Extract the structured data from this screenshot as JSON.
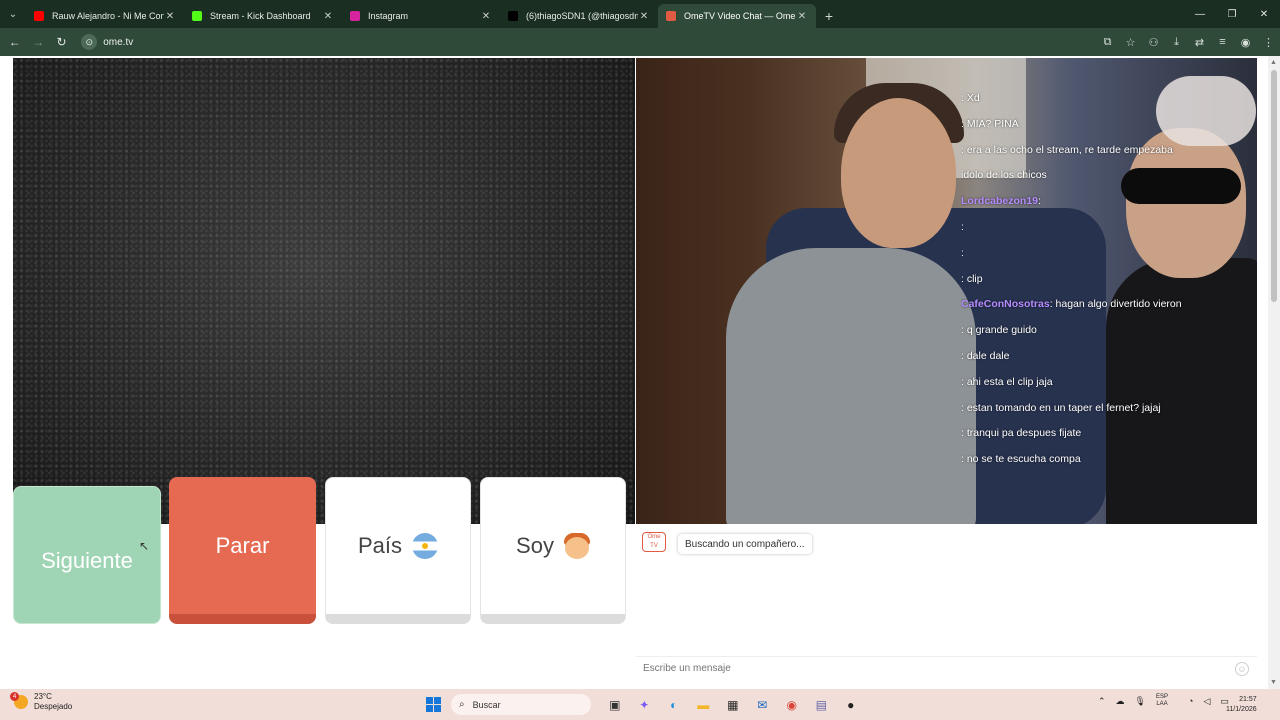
{
  "browser": {
    "tabs": [
      {
        "title": "Rauw Alejandro - Ni Me Conoc",
        "favicon_color": "#ff0000",
        "active": false
      },
      {
        "title": "Stream - Kick Dashboard",
        "favicon_color": "#53fc18",
        "active": false
      },
      {
        "title": "Instagram",
        "favicon_color": "#d6249f",
        "active": false
      },
      {
        "title": "(6)thiagoSDN1 (@thiagosdn1)",
        "favicon_color": "#000000",
        "active": false
      },
      {
        "title": "OmeTV Video Chat — Ome",
        "favicon_color": "#e05a44",
        "active": true
      }
    ],
    "new_tab": "+",
    "url": "ome.tv",
    "window_controls": {
      "minimize": "—",
      "maximize": "❐",
      "close": "✕"
    }
  },
  "video": {
    "chat_overlay": [
      {
        "user": "",
        "message": ": Xd"
      },
      {
        "user": "",
        "message": ": MIA? PINA"
      },
      {
        "user": "",
        "message": ": era a las ocho el stream, re tarde empezaba"
      },
      {
        "user": "",
        "message": "idolo de los chicos"
      },
      {
        "user": "Lordcabezon19",
        "message": ":"
      },
      {
        "user": "",
        "message": ":"
      },
      {
        "user": "",
        "message": ":"
      },
      {
        "user": "",
        "message": ": clip"
      },
      {
        "user": "CafeConNosotras",
        "message": ": hagan algo divertido vieron"
      },
      {
        "user": "",
        "message": ": q grande guido"
      },
      {
        "user": "",
        "message": ": dale dale"
      },
      {
        "user": "",
        "message": ": ahi esta el clip jaja"
      },
      {
        "user": "",
        "message": ": estan tomando en un taper el fernet? jajaj"
      },
      {
        "user": "",
        "message": ": tranqui pa despues fijate"
      },
      {
        "user": "",
        "message": ": no se te escucha compa"
      }
    ]
  },
  "controls": {
    "next_label": "Siguiente",
    "stop_label": "Parar",
    "country_label": "País",
    "soy_label": "Soy",
    "next_color": "#9fd5b4",
    "stop_color": "#e66a52"
  },
  "chat": {
    "logo_text": "Ome TV",
    "status_message": "Buscando un compañero...",
    "input_placeholder": "Escribe un mensaje"
  },
  "taskbar": {
    "weather_temp": "23°C",
    "weather_desc": "Despejado",
    "notification_count": "4",
    "search_placeholder": "Buscar",
    "lang_line1": "ESP",
    "lang_line2": "LAA",
    "time": "21:57",
    "date": "11/1/2026"
  }
}
